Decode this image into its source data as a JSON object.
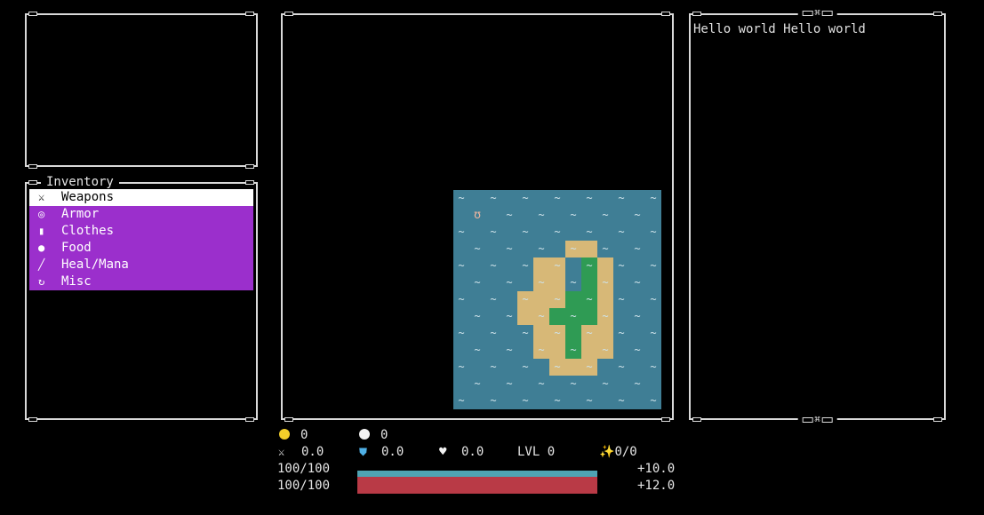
{
  "inventory": {
    "title": "Inventory",
    "items": [
      {
        "label": "Weapons",
        "icon": "⚔",
        "icon_name": "crossed-swords-icon",
        "selected": true
      },
      {
        "label": "Armor",
        "icon": "◎",
        "icon_name": "target-shield-icon",
        "selected": false
      },
      {
        "label": "Clothes",
        "icon": "▮",
        "icon_name": "jacket-icon",
        "selected": false
      },
      {
        "label": "Food",
        "icon": "●",
        "icon_name": "apple-icon",
        "selected": false
      },
      {
        "label": "Heal/Mana",
        "icon": "╱",
        "icon_name": "syringe-icon",
        "selected": false
      },
      {
        "label": "Misc",
        "icon": "↻",
        "icon_name": "misc-icon",
        "selected": false
      }
    ]
  },
  "log": {
    "text": "Hello world Hello world"
  },
  "map": {
    "sand": [
      [
        7,
        3
      ],
      [
        8,
        3
      ],
      [
        5,
        4
      ],
      [
        6,
        4
      ],
      [
        8,
        4
      ],
      [
        9,
        4
      ],
      [
        5,
        5
      ],
      [
        6,
        5
      ],
      [
        9,
        5
      ],
      [
        4,
        6
      ],
      [
        5,
        6
      ],
      [
        6,
        6
      ],
      [
        9,
        6
      ],
      [
        4,
        7
      ],
      [
        5,
        7
      ],
      [
        8,
        7
      ],
      [
        9,
        7
      ],
      [
        5,
        8
      ],
      [
        6,
        8
      ],
      [
        7,
        8
      ],
      [
        8,
        8
      ],
      [
        9,
        8
      ],
      [
        5,
        9
      ],
      [
        6,
        9
      ],
      [
        8,
        9
      ],
      [
        9,
        9
      ],
      [
        6,
        10
      ],
      [
        7,
        10
      ],
      [
        8,
        10
      ]
    ],
    "grass": [
      [
        8,
        4
      ],
      [
        8,
        5
      ],
      [
        7,
        6
      ],
      [
        8,
        6
      ],
      [
        6,
        7
      ],
      [
        7,
        7
      ],
      [
        8,
        7
      ],
      [
        7,
        8
      ],
      [
        7,
        9
      ]
    ],
    "player": [
      1,
      1
    ]
  },
  "stats": {
    "gold": "0",
    "orb": "0",
    "attack": "0.0",
    "defense": "0.0",
    "health_stat": "0.0",
    "level": "LVL 0",
    "xp": "0/0",
    "hp_text": "100/100",
    "mp_text": "100/100",
    "hp_regen": "+10.0",
    "mp_regen": "+12.0",
    "hp_fraction": 1.0,
    "mp_fraction": 1.0
  },
  "colors": {
    "inventory_highlight": "#9b2fcc",
    "water": "#3f7e95",
    "sand": "#d7b877",
    "grass": "#2f9b54",
    "hp_bar": "#4fa3b3",
    "mp_bar": "#b93a46",
    "gold": "#f3cf2a"
  }
}
